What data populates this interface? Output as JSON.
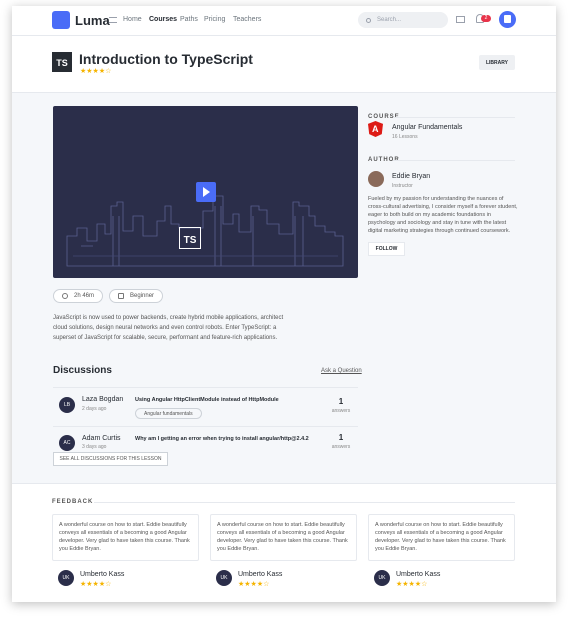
{
  "nav": {
    "brand": "Luma",
    "links": [
      "Home",
      "Courses",
      "Paths",
      "Pricing",
      "Teachers"
    ],
    "active_link": "Courses",
    "search_placeholder": "Search...",
    "notification_count": "2"
  },
  "course": {
    "title": "Introduction to TypeScript",
    "icon_text": "TS",
    "rating_stars": "★★★★☆",
    "rating": 4,
    "library_button": "LIBRARY",
    "duration": "2h 46m",
    "level": "Beginner",
    "video_logo": "TS",
    "description": "JavaScript is now used to power backends, create hybrid mobile applications, architect cloud solutions, design neural networks and even control robots. Enter TypeScript: a superset of JavaScript for scalable, secure, performant and feature-rich applications."
  },
  "discussions": {
    "title": "Discussions",
    "ask_link": "Ask a Question",
    "items": [
      {
        "initials": "LB",
        "name": "Laza Bogdan",
        "time": "2 days ago",
        "question": "Using Angular HttpClientModule instead of HttpModule",
        "tag": "Angular fundamentals",
        "count": "1",
        "answers_label": "answers"
      },
      {
        "initials": "AC",
        "name": "Adam Curtis",
        "time": "3 days ago",
        "question": "Why am I getting an error when trying to install angular/http@2.4.2",
        "tag": "",
        "count": "1",
        "answers_label": "answers"
      }
    ],
    "see_all": "SEE ALL DISCUSSIONS FOR THIS LESSON"
  },
  "sidebar": {
    "course_heading": "COURSE",
    "course_name": "Angular Fundamentals",
    "course_lessons": "16 Lessons",
    "author_heading": "AUTHOR",
    "author_name": "Eddie Bryan",
    "author_role": "Instructor",
    "author_bio": "Fueled by my passion for understanding the nuances of cross-cultural advertising, I consider myself a forever student, eager to both build on my academic foundations in psychology and sociology and stay in tune with the latest digital marketing strategies through continued coursework.",
    "follow_button": "FOLLOW"
  },
  "feedback": {
    "heading": "FEEDBACK",
    "items": [
      {
        "text": "A wonderful course on how to start. Eddie beautifully conveys all essentials of a becoming a good Angular developer. Very glad to have taken this course. Thank you Eddie Bryan.",
        "initials": "UK",
        "name": "Umberto Kass",
        "stars": "★★★★☆"
      },
      {
        "text": "A wonderful course on how to start. Eddie beautifully conveys all essentials of a becoming a good Angular developer. Very glad to have taken this course. Thank you Eddie Bryan.",
        "initials": "UK",
        "name": "Umberto Kass",
        "stars": "★★★★☆"
      },
      {
        "text": "A wonderful course on how to start. Eddie beautifully conveys all essentials of a becoming a good Angular developer. Very glad to have taken this course. Thank you Eddie Bryan.",
        "initials": "UK",
        "name": "Umberto Kass",
        "stars": "★★★★☆"
      }
    ]
  },
  "colors": {
    "accent": "#4a6cf7",
    "star": "#f5b400",
    "badge": "#e8344a",
    "video_bg": "#2b2e4a"
  }
}
